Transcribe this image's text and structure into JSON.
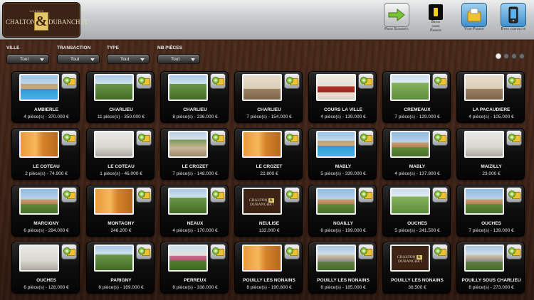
{
  "header": {
    "logo": {
      "agence": "AGENCE",
      "name_left": "CHALTON",
      "amp": "&",
      "name_right": "DUBANCHET"
    },
    "buttons": {
      "next_page": "Page Suivante",
      "basket_count": "0",
      "basket_label_1": "Biens",
      "basket_label_2": "dans",
      "basket_label_3": "Panier",
      "view_basket": "Voir Panier",
      "contact": "Être contacté"
    }
  },
  "filters": {
    "ville": {
      "label": "VILLE",
      "value": "Tout"
    },
    "transaction": {
      "label": "TRANSACTION",
      "value": "Tout"
    },
    "type": {
      "label": "TYPE",
      "value": "Tout"
    },
    "nb_pieces": {
      "label": "NB PIÈCES",
      "value": "Tout"
    }
  },
  "pager": {
    "pages": 4,
    "active": 1
  },
  "listings": [
    {
      "city": "AMBIERLE",
      "info": "4 pièce(s) - 370.000 €",
      "photo": "pool"
    },
    {
      "city": "CHARLIEU",
      "info": "11 pièce(s) - 350.000 €",
      "photo": "garden"
    },
    {
      "city": "CHARLIEU",
      "info": "8 pièce(s) - 236.000 €",
      "photo": "garden"
    },
    {
      "city": "CHARLIEU",
      "info": "7 pièce(s) - 154.000 €",
      "photo": "room"
    },
    {
      "city": "COURS LA VILLE",
      "info": "4 pièce(s) - 139.000 €",
      "photo": "red"
    },
    {
      "city": "CREMEAUX",
      "info": "7 pièce(s) - 129.000 €",
      "photo": "field"
    },
    {
      "city": "LA PACAUDIERE",
      "info": "4 pièce(s) - 105.000 €",
      "photo": "room"
    },
    {
      "city": "LE COTEAU",
      "info": "2 pièce(s) - 74.900 €",
      "photo": "door"
    },
    {
      "city": "LE COTEAU",
      "info": "1 pièce(s) - 46.000 €",
      "photo": "white"
    },
    {
      "city": "LE CROZET",
      "info": "7 pièce(s) - 148.000 €",
      "photo": "path"
    },
    {
      "city": "LE CROZET",
      "info": "22.800 €",
      "photo": "door"
    },
    {
      "city": "MABLY",
      "info": "5 pièce(s) - 339.000 €",
      "photo": "pool"
    },
    {
      "city": "MABLY",
      "info": "4 pièce(s) - 137.800 €",
      "photo": "house"
    },
    {
      "city": "MAIZILLY",
      "info": "23.000 €",
      "photo": "white"
    },
    {
      "city": "MARCIGNY",
      "info": "6 pièce(s) - 294.000 €",
      "photo": "house"
    },
    {
      "city": "MONTAGNY",
      "info": "246.200 €",
      "photo": "door"
    },
    {
      "city": "NEAUX",
      "info": "4 pièce(s) - 170.000 €",
      "photo": "garden"
    },
    {
      "city": "NEULISE",
      "info": "132.000 €",
      "photo": "logo"
    },
    {
      "city": "NOAILLY",
      "info": "6 pièce(s) - 199.000 €",
      "photo": "house"
    },
    {
      "city": "OUCHES",
      "info": "5 pièce(s) - 241.500 €",
      "photo": "field"
    },
    {
      "city": "OUCHES",
      "info": "7 pièce(s) - 139.000 €",
      "photo": "house"
    },
    {
      "city": "OUCHES",
      "info": "6 pièce(s) - 128.000 €",
      "photo": "white"
    },
    {
      "city": "PARIGNY",
      "info": "6 pièce(s) - 169.000 €",
      "photo": "garden"
    },
    {
      "city": "PERREUX",
      "info": "6 pièce(s) - 338.000 €",
      "photo": "flowers"
    },
    {
      "city": "POUILLY LES NONAINS",
      "info": "8 pièce(s) - 190.800 €",
      "photo": "door"
    },
    {
      "city": "POUILLY LES NONAINS",
      "info": "6 pièce(s) - 185.000 €",
      "photo": "street"
    },
    {
      "city": "POUILLY LES NONAINS",
      "info": "38.500 €",
      "photo": "logo"
    },
    {
      "city": "POUILLY SOUS CHARLIEU",
      "info": "8 pièce(s) - 273.000 €",
      "photo": "street"
    }
  ],
  "icons": {
    "next": "arrow-right-icon",
    "basket": "basket-counter-icon",
    "view_basket": "basket-folder-icon",
    "contact": "phone-icon",
    "add": "add-to-basket-icon"
  },
  "colors": {
    "accent_gold": "#e3c66a",
    "logo_brown": "#3b2316",
    "add_green": "#8ac43a"
  }
}
